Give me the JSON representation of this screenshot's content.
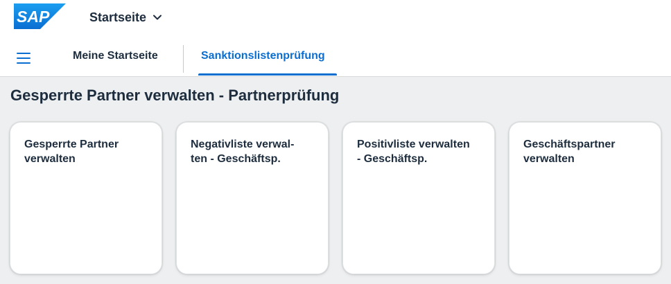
{
  "shell": {
    "logo_text": "SAP",
    "logo_color": "#0a6ed1",
    "app_title": "Startseite",
    "app_title_icon": "chevron-down-icon"
  },
  "tabs": {
    "menu_icon": "hamburger-menu-icon",
    "items": [
      {
        "label": "Meine Startseite",
        "active": false
      },
      {
        "label": "Sanktionslistenprüfung",
        "active": true
      }
    ],
    "active_color": "#0a6ed1"
  },
  "section": {
    "title": "Gesperrte Partner verwalten - Partnerprüfung"
  },
  "tiles": [
    {
      "line1": "Gesperrte Partner",
      "line2": "verwalten"
    },
    {
      "line1": "Negativliste verwal-",
      "line2": "ten - Geschäftsp."
    },
    {
      "line1": "Positivliste verwalten",
      "line2": "- Geschäftsp."
    },
    {
      "line1": "Geschäftspartner",
      "line2": "verwalten"
    }
  ]
}
